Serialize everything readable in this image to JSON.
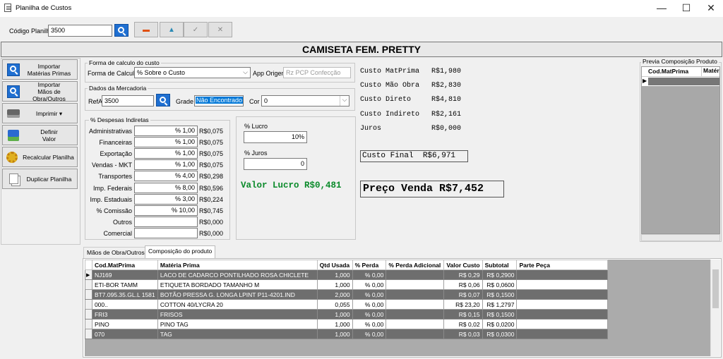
{
  "window": {
    "title": "Planilha de Custos",
    "minimize": "—",
    "maximize": "☐",
    "close": "✕"
  },
  "toolbar": {
    "codigo_label": "Código Planilha",
    "codigo_value": "3500",
    "btn_delete": "▬",
    "btn_up": "▲",
    "btn_check": "✓",
    "btn_cancel": "✕"
  },
  "header": {
    "title": "CAMISETA FEM. PRETTY"
  },
  "sidebar": {
    "importar_materias": "Importar\nMatérias Primas",
    "importar_maos": "Importar\nMãos de Obra/Outros",
    "imprimir": "Imprimir ▾",
    "definir_valor": "Definir\nValor",
    "recalcular": "Recalcular Planilha",
    "duplicar": "Duplicar Planilha"
  },
  "calc": {
    "group_title": "Forma de calculo do custo",
    "forma_label": "Forma de Calcular",
    "forma_value": "% Sobre o Custo",
    "app_origem_label": "App Origem",
    "app_origem_placeholder": "Rz PCP Confecção"
  },
  "merc": {
    "group_title": "Dados da Mercadoria",
    "ref_label": "RefA",
    "ref_value": "3500",
    "grade_label": "Grade",
    "grade_value": "Não Encontrado Gr",
    "cor_label": "Cor",
    "cor_value": "0"
  },
  "despesas": {
    "group_title": "% Despesas Indiretas",
    "rows": [
      {
        "label": "Administrativas",
        "pct": "% 1,00",
        "val": "R$0,075"
      },
      {
        "label": "Financeiras",
        "pct": "% 1,00",
        "val": "R$0,075"
      },
      {
        "label": "Exportação",
        "pct": "% 1,00",
        "val": "R$0,075"
      },
      {
        "label": "Vendas - MKT",
        "pct": "% 1,00",
        "val": "R$0,075"
      },
      {
        "label": "Transportes",
        "pct": "% 4,00",
        "val": "R$0,298"
      },
      {
        "label": "Imp. Federais",
        "pct": "% 8,00",
        "val": "R$0,596"
      },
      {
        "label": "Imp. Estaduais",
        "pct": "% 3,00",
        "val": "R$0,224"
      },
      {
        "label": "% Comissão",
        "pct": "% 10,00",
        "val": "R$0,745"
      },
      {
        "label": "Outros",
        "pct": "",
        "val": "R$0,000"
      },
      {
        "label": "Comercial",
        "pct": "",
        "val": "R$0,000"
      }
    ]
  },
  "lucro": {
    "lucro_label": "% Lucro",
    "lucro_value": "10%",
    "juros_label": "% Juros",
    "juros_value": "0",
    "valor_lucro": "Valor Lucro R$0,481"
  },
  "costs": {
    "items": [
      {
        "label": "Custo MatPrima",
        "value": "R$1,980"
      },
      {
        "label": "Custo Mão Obra",
        "value": "R$2,830"
      },
      {
        "label": "Custo Direto",
        "value": "R$4,810"
      },
      {
        "label": "Custo Indireto",
        "value": "R$2,161"
      },
      {
        "label": "Juros",
        "value": "R$0,000"
      }
    ],
    "custo_final": "Custo Final  R$6,971",
    "preco_venda": "Preço Venda R$7,452"
  },
  "previa": {
    "title": "Previa Composição Produto",
    "col1": "Cod.MatPrima",
    "col2": "Matér"
  },
  "tabs": {
    "tab1": "Mãos de Obra/Outros",
    "tab2": "Composição do produto"
  },
  "grid": {
    "headers": [
      "Cod.MatPrima",
      "Matéria Prima",
      "Qtd Usada",
      "% Perda",
      "% Perda Adicional",
      "Valor Custo",
      "Subtotal",
      "Parte Peça"
    ],
    "rows": [
      [
        "NJ169",
        "LACO DE CADARCO PONTILHADO ROSA CHICLETE",
        "1,000",
        "% 0,00",
        "",
        "R$ 0,29",
        "R$ 0,2900",
        ""
      ],
      [
        "ETI-BOR TAMM",
        "ETIQUETA BORDADO TAMANHO M",
        "1,000",
        "% 0,00",
        "",
        "R$ 0,06",
        "R$ 0,0600",
        ""
      ],
      [
        "BT7.095.35.GL.L 1581",
        "BOTÃO PRESSA G. LONGA LPINT P11-4201.IND",
        "2,000",
        "% 0,00",
        "",
        "R$ 0,07",
        "R$ 0,1500",
        ""
      ],
      [
        "000..",
        "COTTON 40/LYCRA 20",
        "0,055",
        "% 0,00",
        "",
        "R$ 23,20",
        "R$ 1,2797",
        ""
      ],
      [
        "FRI3",
        "FRISOS",
        "1,000",
        "% 0,00",
        "",
        "R$ 0,15",
        "R$ 0,1500",
        ""
      ],
      [
        "PINO",
        "PINO TAG",
        "1,000",
        "% 0,00",
        "",
        "R$ 0,02",
        "R$ 0,0200",
        ""
      ],
      [
        "070",
        "TAG",
        "1,000",
        "% 0,00",
        "",
        "R$ 0,03",
        "R$ 0,0300",
        ""
      ]
    ]
  }
}
